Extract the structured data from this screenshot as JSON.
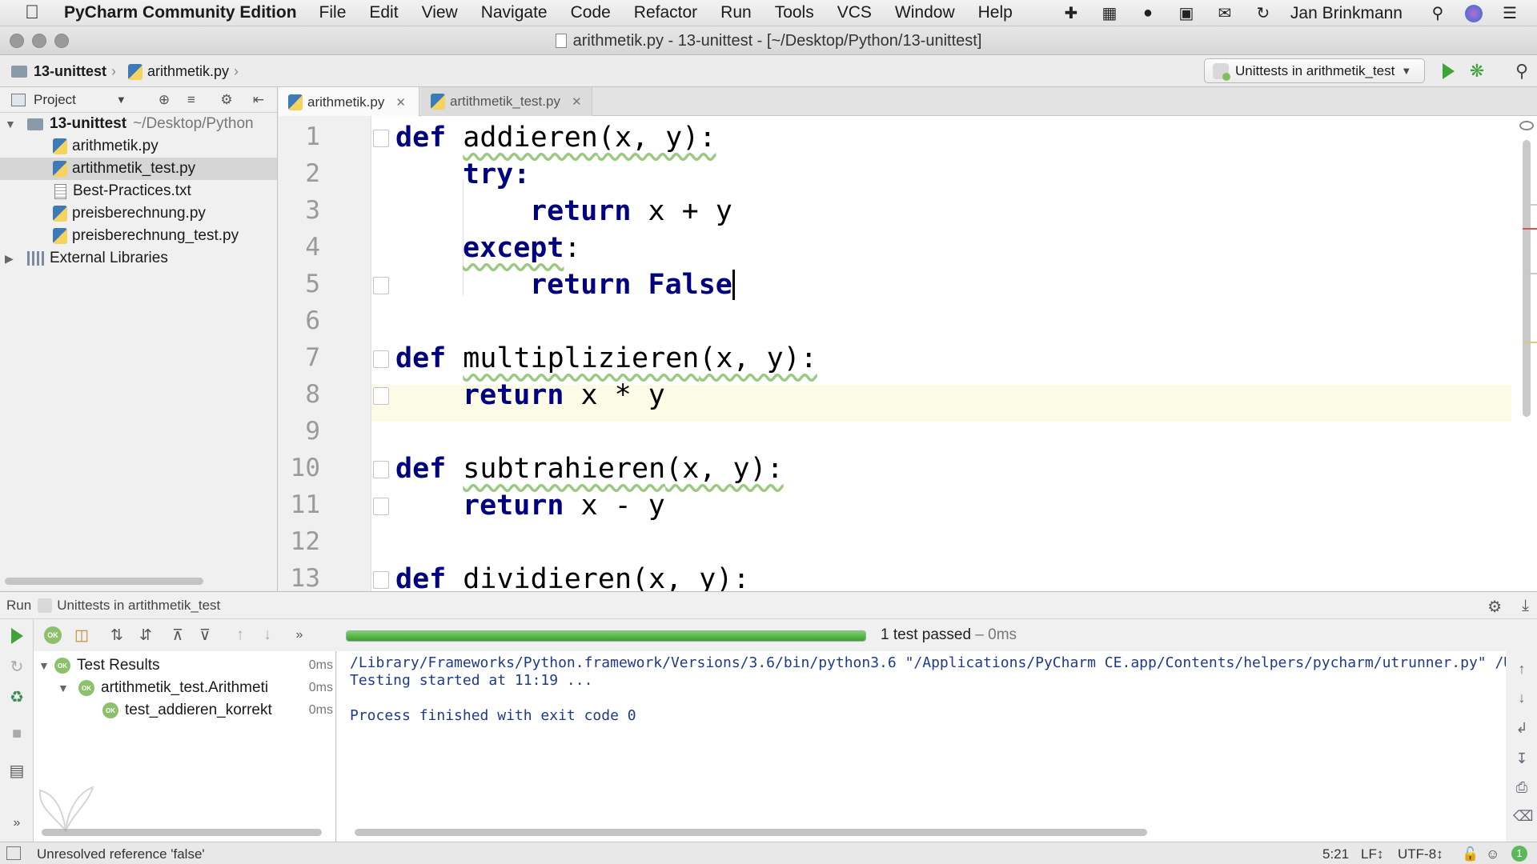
{
  "menubar": {
    "app_name": "PyCharm Community Edition",
    "items": [
      "File",
      "Edit",
      "View",
      "Navigate",
      "Code",
      "Refactor",
      "Run",
      "Tools",
      "VCS",
      "Window",
      "Help"
    ],
    "user": "Jan Brinkmann"
  },
  "window": {
    "title": "arithmetik.py - 13-unittest - [~/Desktop/Python/13-unittest]"
  },
  "navbar": {
    "project_crumb": "13-unittest",
    "file_crumb": "arithmetik.py",
    "run_config": "Unittests in arithmetik_test"
  },
  "project": {
    "header": "Project",
    "root": "13-unittest",
    "root_path": "~/Desktop/Python",
    "files": [
      "arithmetik.py",
      "artithmetik_test.py",
      "Best-Practices.txt",
      "preisberechnung.py",
      "preisberechnung_test.py"
    ],
    "selected_file": "artithmetik_test.py",
    "external": "External Libraries"
  },
  "tabs": [
    {
      "label": "arithmetik.py",
      "active": true
    },
    {
      "label": "artithmetik_test.py",
      "active": false
    }
  ],
  "editor": {
    "line_numbers": [
      "1",
      "2",
      "3",
      "4",
      "5",
      "6",
      "7",
      "8",
      "9",
      "10",
      "11",
      "12",
      "13"
    ],
    "current_line": 5,
    "cursor_position": "5:21"
  },
  "code": {
    "kw_def": "def",
    "kw_try": "try",
    "kw_return": "return",
    "kw_except": "except",
    "kw_false": "False",
    "l1_name": "addieren",
    "l1_rest": "(x, y):",
    "l2_colon": ":",
    "l3_expr": " x + y",
    "l4_colon": ":",
    "l7_name": "multiplizieren",
    "l7_rest": "(x, y):",
    "l8_expr": " x * y",
    "l10_name": "subtrahieren",
    "l10_rest": "(x, y):",
    "l11_expr": " x - y",
    "l13_name": "dividieren",
    "l13_rest": "(x, y):"
  },
  "run": {
    "label": "Run",
    "config": "Unittests in artithmetik_test",
    "progress_fraction": 1.0,
    "progress_text": "1 test passed",
    "progress_time": "– 0ms",
    "ok_label": "OK",
    "tests": [
      {
        "name": "Test Results",
        "time": "0ms"
      },
      {
        "name": "artithmetik_test.Arithmeti",
        "time": "0ms"
      },
      {
        "name": "test_addieren_korrekt",
        "time": "0ms"
      }
    ],
    "console": [
      "/Library/Frameworks/Python.framework/Versions/3.6/bin/python3.6 \"/Applications/PyCharm CE.app/Contents/helpers/pycharm/utrunner.py\" /User",
      "Testing started at 11:19 ...",
      "",
      "Process finished with exit code 0"
    ]
  },
  "status": {
    "message": "Unresolved reference 'false'",
    "position": "5:21",
    "line_sep": "LF↕",
    "encoding": "UTF-8↕",
    "notifications": "1"
  },
  "colors": {
    "keyword": "#000080",
    "current_line": "#fcfbe5",
    "progress": "#3d9e2f",
    "ok": "#8cc16b"
  }
}
